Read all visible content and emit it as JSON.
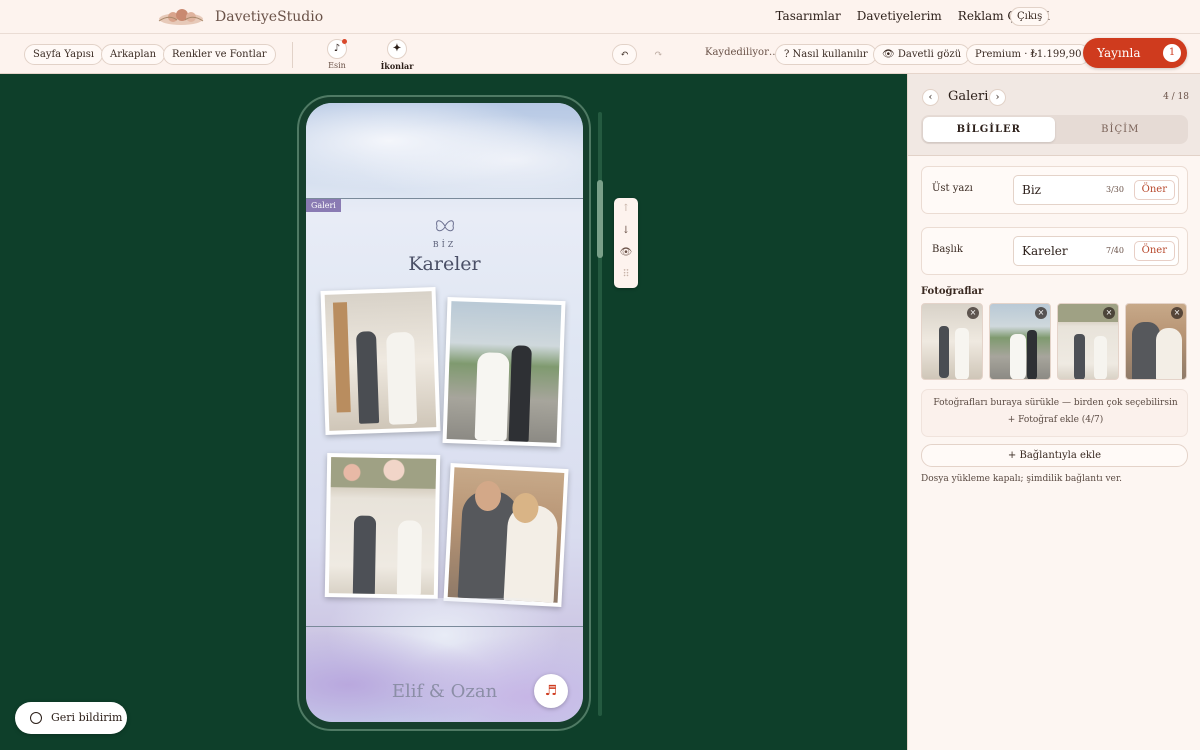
{
  "brand": {
    "name": "DavetiyeStudio"
  },
  "nav": {
    "links": [
      "Tasarımlar",
      "Davetiyelerim",
      "Reklam Çekimi"
    ],
    "logout": "Çıkış"
  },
  "toolbar": {
    "pills": [
      "Sayfa Yapısı",
      "Arkaplan",
      "Renkler ve Fontlar"
    ],
    "tools": [
      {
        "label": "Esin",
        "icon": "music-note-icon"
      },
      {
        "label": "İkonlar",
        "icon": "sparkle-icon"
      }
    ],
    "undo_icon": "undo-icon",
    "redo_icon": "redo-icon",
    "status": "Kaydediliyor…",
    "help": "? Nasıl kullanılır",
    "guest_view": "👁 Davetli gözü",
    "premium": "Premium · ₺1.199,90",
    "publish": "Yayınla",
    "publish_count": "1"
  },
  "preview": {
    "section_tag": "Galeri",
    "upper_text": "BİZ",
    "title": "Kareler",
    "names": "Elif & Ozan",
    "music_icon": "music-icon"
  },
  "side_tools": [
    "↑",
    "↓",
    "👁",
    "⠿"
  ],
  "panel": {
    "title": "Galeri",
    "counter": "4 / 18",
    "tabs": [
      "BİLGİLER",
      "BİÇİM"
    ],
    "fields": [
      {
        "label": "Üst yazı",
        "value": "Biz",
        "count": "3/30",
        "suggest": "Öner"
      },
      {
        "label": "Başlık",
        "value": "Kareler",
        "count": "7/40",
        "suggest": "Öner"
      }
    ],
    "photos_label": "Fotoğraflar",
    "dropzone_line1": "Fotoğrafları buraya sürükle — birden çok seçebilirsin",
    "dropzone_line2": "+ Fotoğraf ekle (4/7)",
    "link_add": "+ Bağlantıyla ekle",
    "note": "Dosya yükleme kapalı; şimdilik bağlantı ver."
  },
  "feedback": "Geri bildirim"
}
